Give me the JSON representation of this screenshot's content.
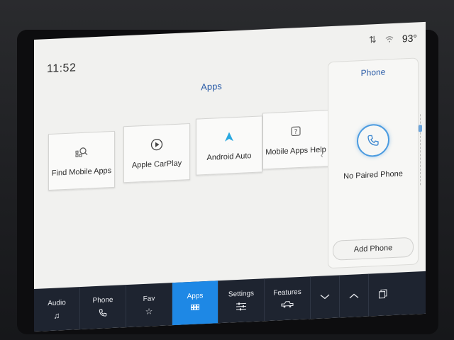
{
  "status": {
    "time": "11:52",
    "temperature": "93°",
    "sort_icon": "transfer-arrows-icon",
    "wifi_icon": "wifi-icon"
  },
  "apps_panel": {
    "title": "Apps",
    "tiles": [
      {
        "label": "Find Mobile Apps",
        "icon": "app-search-icon"
      },
      {
        "label": "Apple CarPlay",
        "icon": "carplay-icon"
      },
      {
        "label": "Android Auto",
        "icon": "android-auto-icon"
      },
      {
        "label": "Mobile Apps Help",
        "icon": "help-icon"
      }
    ]
  },
  "phone_panel": {
    "title": "Phone",
    "status_text": "No Paired Phone",
    "add_button": "Add Phone"
  },
  "nav": {
    "items": [
      {
        "label": "Audio",
        "icon": "music-note-icon"
      },
      {
        "label": "Phone",
        "icon": "phone-icon"
      },
      {
        "label": "Fav",
        "icon": "star-icon"
      },
      {
        "label": "Apps",
        "icon": "apps-grid-icon"
      },
      {
        "label": "Settings",
        "icon": "settings-sliders-icon"
      },
      {
        "label": "Features",
        "icon": "truck-icon"
      },
      {
        "label": "",
        "icon": "chevron-down-icon"
      },
      {
        "label": "",
        "icon": "chevron-up-icon"
      },
      {
        "label": "",
        "icon": "copy-screens-icon"
      }
    ],
    "active": "Apps"
  },
  "colors": {
    "accent": "#1e88e5",
    "nav_bg": "#1e2430",
    "screen_bg": "#f1f1ef",
    "title_blue": "#2d5ea8"
  }
}
